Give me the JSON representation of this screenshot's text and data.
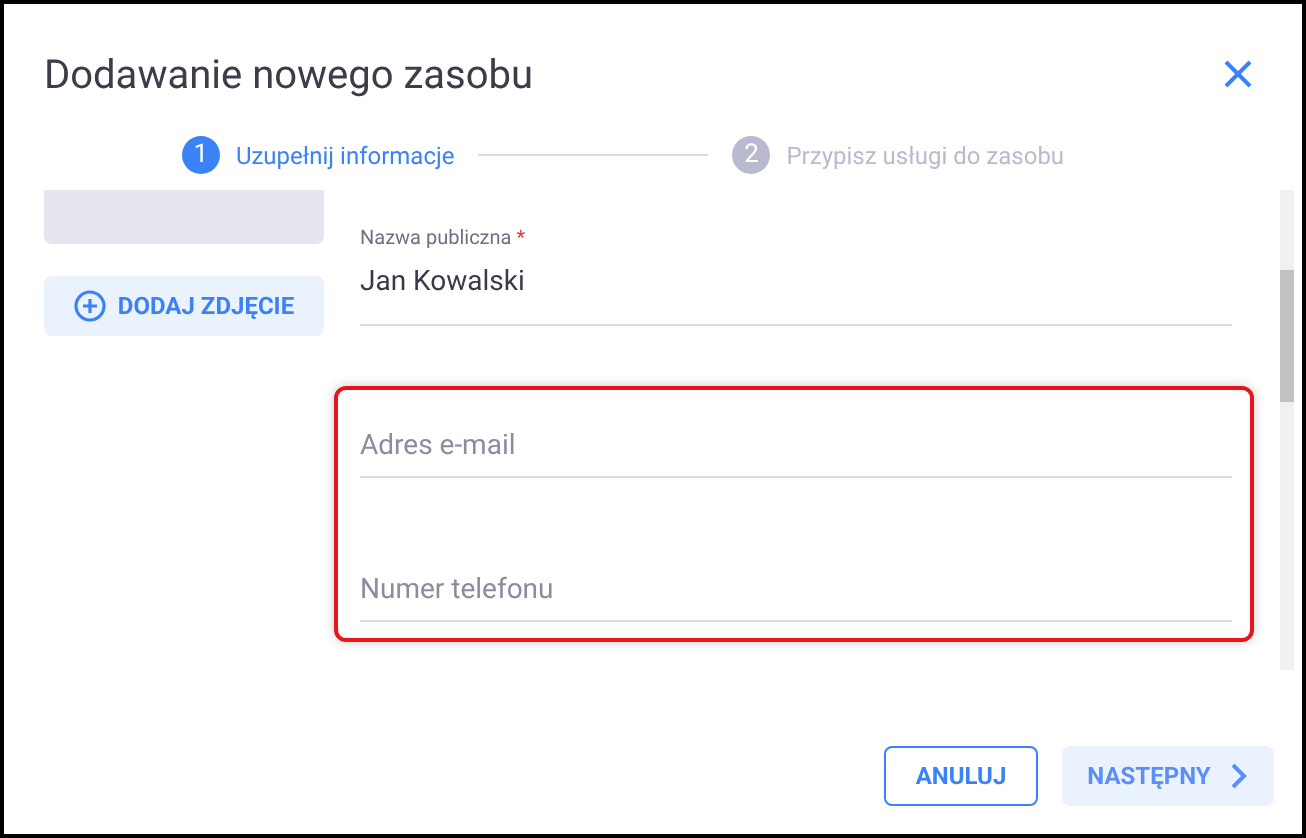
{
  "dialog": {
    "title": "Dodawanie nowego zasobu"
  },
  "steps": [
    {
      "number": "1",
      "label": "Uzupełnij informacje",
      "active": true
    },
    {
      "number": "2",
      "label": "Przypisz usługi do zasobu",
      "active": false
    }
  ],
  "photo": {
    "button": "DODAJ ZDJĘCIE"
  },
  "groups": [
    {
      "highlighted": false,
      "fields": [
        {
          "kind": "filled",
          "label": "Nazwa publiczna",
          "required_mark": "*",
          "value": "Jan Kowalski"
        }
      ]
    },
    {
      "highlighted": true,
      "fields": [
        {
          "kind": "empty",
          "placeholder": "Adres e-mail"
        },
        {
          "kind": "empty",
          "placeholder": "Numer telefonu"
        }
      ]
    }
  ],
  "buttons": {
    "cancel": "ANULUJ",
    "next": "NASTĘPNY"
  }
}
